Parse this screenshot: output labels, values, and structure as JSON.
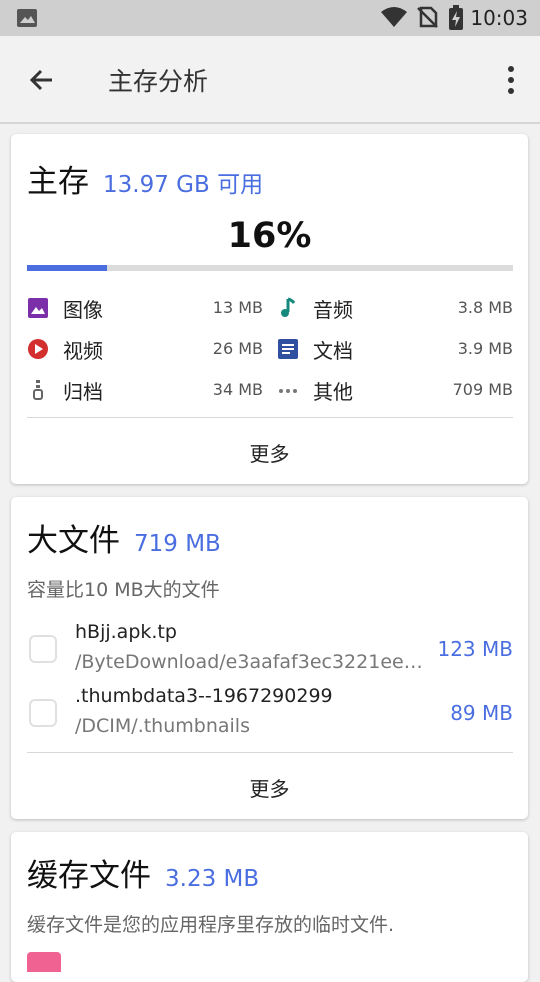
{
  "status_bar": {
    "time": "10:03"
  },
  "app_bar": {
    "title": "主存分析"
  },
  "main_storage": {
    "title": "主存",
    "available": "13.97 GB 可用",
    "percent_text": "16%",
    "usage_fraction": 0.165,
    "categories": [
      {
        "label": "图像",
        "size": "13 MB"
      },
      {
        "label": "音频",
        "size": "3.8 MB"
      },
      {
        "label": "视频",
        "size": "26 MB"
      },
      {
        "label": "文档",
        "size": "3.9 MB"
      },
      {
        "label": "归档",
        "size": "34 MB"
      },
      {
        "label": "其他",
        "size": "709 MB"
      }
    ],
    "more_label": "更多"
  },
  "large_files": {
    "title": "大文件",
    "total": "719 MB",
    "description": "容量比10 MB大的文件",
    "files": [
      {
        "name": "hBjj.apk.tp",
        "path": "/ByteDownload/e3aafaf3ec3221ee5…",
        "size": "123 MB"
      },
      {
        "name": ".thumbdata3--1967290299",
        "path": "/DCIM/.thumbnails",
        "size": "89 MB"
      }
    ],
    "more_label": "更多"
  },
  "cache_files": {
    "title": "缓存文件",
    "total": "3.23 MB",
    "description": "缓存文件是您的应用程序里存放的临时文件."
  },
  "colors": {
    "accent": "#4a6ee0",
    "image": "#7b2fa8",
    "audio": "#14897e",
    "video": "#d32f2f",
    "document": "#2f4fa0"
  }
}
